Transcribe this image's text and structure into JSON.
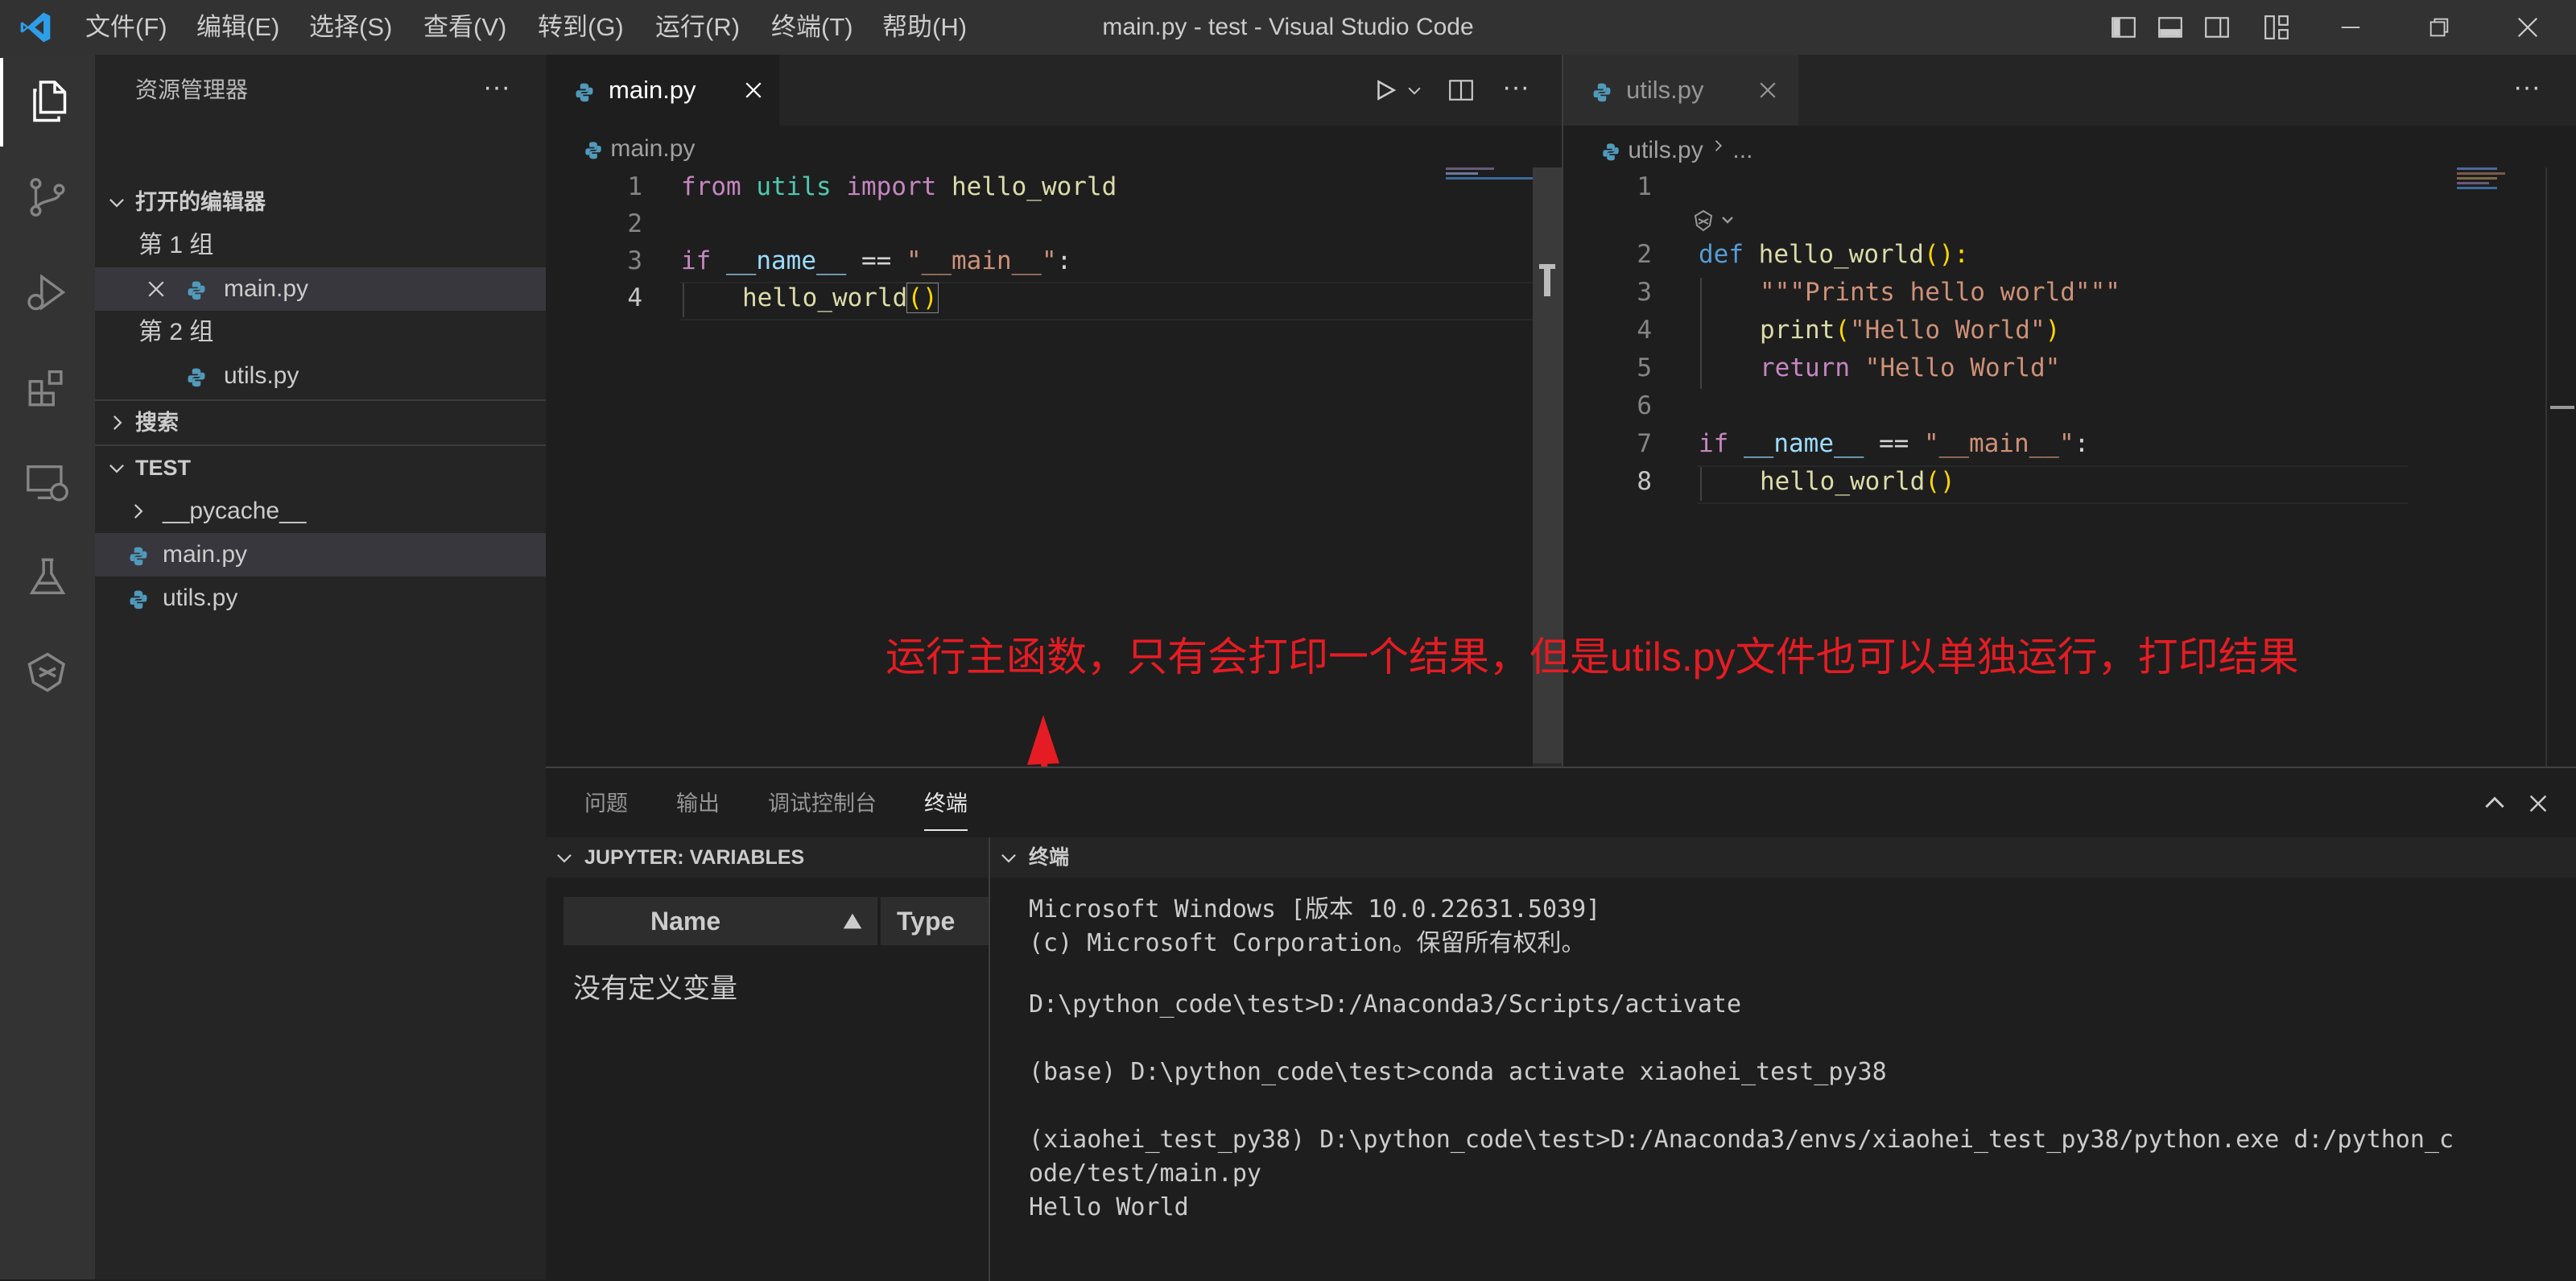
{
  "titlebar": {
    "menus": [
      "文件(F)",
      "编辑(E)",
      "选择(S)",
      "查看(V)",
      "转到(G)",
      "运行(R)",
      "终端(T)",
      "帮助(H)"
    ],
    "title": "main.py - test - Visual Studio Code"
  },
  "sidebar": {
    "header": "资源管理器",
    "open_editors_label": "打开的编辑器",
    "group1_label": "第 1 组",
    "group1_file": "main.py",
    "group2_label": "第 2 组",
    "group2_file": "utils.py",
    "search_label": "搜索",
    "project_label": "TEST",
    "tree": [
      "__pycache__",
      "main.py",
      "utils.py"
    ]
  },
  "editor_left": {
    "tab_label": "main.py",
    "breadcrumb": "main.py",
    "line_numbers": [
      "1",
      "2",
      "3",
      "4"
    ],
    "code": {
      "l1": {
        "kw_from": "from",
        "module": "utils",
        "kw_import": "import",
        "name": "hello_world"
      },
      "l3": {
        "kw_if": "if",
        "dunder": "__name__",
        "op": "==",
        "str": "\"__main__\"",
        "colon": ":"
      },
      "l4": {
        "call": "hello_world",
        "parens": "()"
      }
    }
  },
  "editor_right": {
    "tab_label": "utils.py",
    "breadcrumb_file": "utils.py",
    "breadcrumb_more": "...",
    "line_numbers": [
      "1",
      "2",
      "3",
      "4",
      "5",
      "6",
      "7",
      "8"
    ],
    "code": {
      "l2": {
        "kw_def": "def",
        "fn": "hello_world",
        "rest": "():"
      },
      "l3": {
        "docstring": "\"\"\"Prints hello world\"\"\""
      },
      "l4": {
        "fn": "print",
        "open": "(",
        "str": "\"Hello World\"",
        "close": ")"
      },
      "l5": {
        "kw_return": "return",
        "str": "\"Hello World\""
      },
      "l7": {
        "kw_if": "if",
        "dunder": "__name__",
        "op": "==",
        "str": "\"__main__\"",
        "colon": ":"
      },
      "l8": {
        "call": "hello_world",
        "parens": "()"
      }
    }
  },
  "panel": {
    "tabs": [
      "问题",
      "输出",
      "调试控制台",
      "终端"
    ],
    "active_tab": "终端",
    "variables_header": "JUPYTER: VARIABLES",
    "col_name": "Name",
    "col_type": "Type",
    "empty_message": "没有定义变量",
    "terminal_header": "终端",
    "terminal_lines": [
      "Microsoft Windows [版本 10.0.22631.5039]",
      "(c) Microsoft Corporation。保留所有权利。",
      "",
      "D:\\python_code\\test>D:/Anaconda3/Scripts/activate",
      "",
      "(base) D:\\python_code\\test>conda activate xiaohei_test_py38",
      "",
      "(xiaohei_test_py38) D:\\python_code\\test>D:/Anaconda3/envs/xiaohei_test_py38/python.exe d:/python_c",
      "ode/test/main.py",
      "Hello World"
    ]
  },
  "annotation": {
    "text": "运行主函数，只有会打印一个结果，但是utils.py文件也可以单独运行，打印结果",
    "color": "#e51c23"
  },
  "colors": {
    "accent": "#007acc",
    "python_icon": "#519aba",
    "annotation": "#e51c23"
  }
}
